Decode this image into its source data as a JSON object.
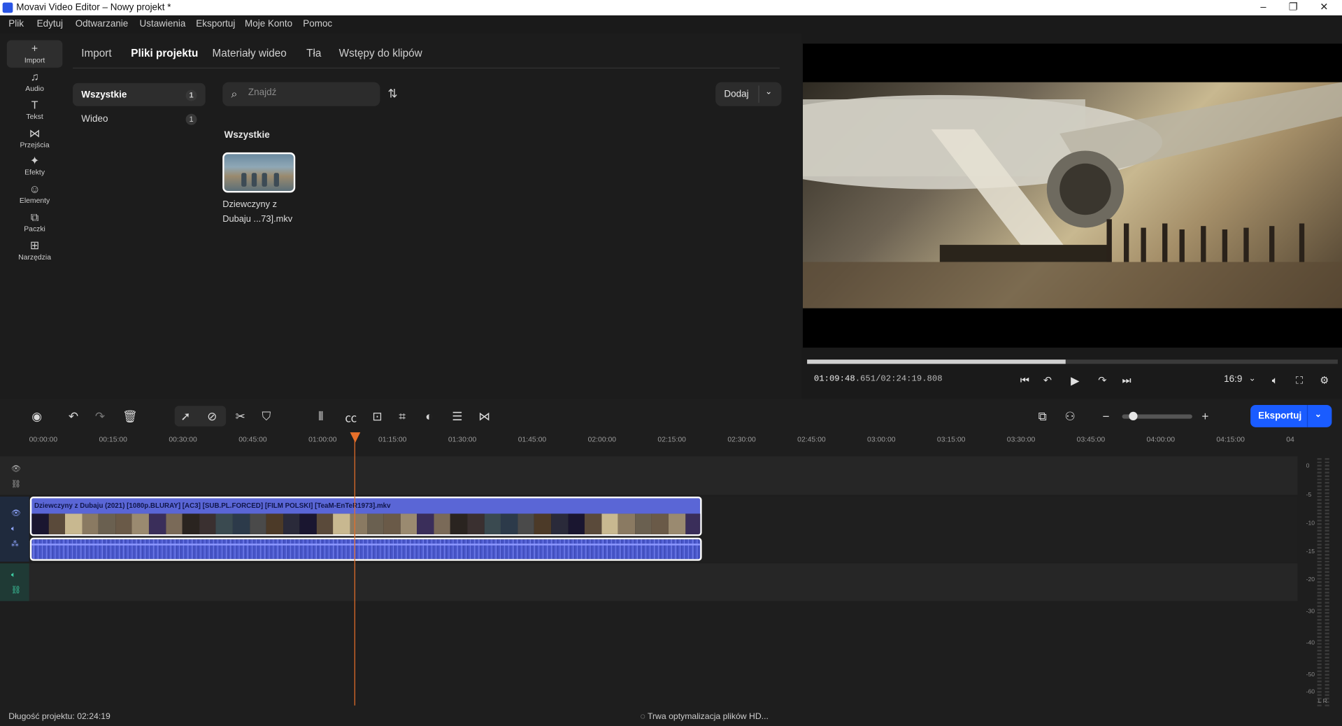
{
  "window": {
    "title": "Movavi Video Editor – Nowy projekt *",
    "minimize": "–",
    "maximize": "❐",
    "close": "✕"
  },
  "menu": [
    "Plik",
    "Edytuj",
    "Odtwarzanie",
    "Ustawienia",
    "Eksportuj",
    "Moje Konto",
    "Pomoc"
  ],
  "sidebar": [
    {
      "label": "Import",
      "icon": "+"
    },
    {
      "label": "Audio",
      "icon": "♫"
    },
    {
      "label": "Tekst",
      "icon": "T"
    },
    {
      "label": "Przejścia",
      "icon": "⋈"
    },
    {
      "label": "Efekty",
      "icon": "✦"
    },
    {
      "label": "Elementy",
      "icon": "☺"
    },
    {
      "label": "Paczki",
      "icon": "⧉"
    },
    {
      "label": "Narzędzia",
      "icon": "⊞"
    }
  ],
  "tabs": [
    "Import",
    "Pliki projektu",
    "Materiały wideo",
    "Tła",
    "Wstępy do klipów"
  ],
  "categories": [
    {
      "label": "Wszystkie",
      "count": "1"
    },
    {
      "label": "Wideo",
      "count": "1"
    }
  ],
  "search": {
    "placeholder": "Znajdź"
  },
  "add_button": {
    "label": "Dodaj"
  },
  "section_title": "Wszystkie",
  "media": {
    "filename": "Dziewczyny z Dubaju ...73].mkv"
  },
  "player": {
    "current": "01:09:48",
    "current_ms": ".651",
    "total": "/02:24:19.808",
    "aspect": "16:9",
    "progress": 0.487
  },
  "export_button": {
    "label": "Eksportuj"
  },
  "ruler": [
    "00:00:00",
    "00:15:00",
    "00:30:00",
    "00:45:00",
    "01:00:00",
    "01:15:00",
    "01:30:00",
    "01:45:00",
    "02:00:00",
    "02:15:00",
    "02:30:00",
    "02:45:00",
    "03:00:00",
    "03:15:00",
    "03:30:00",
    "03:45:00",
    "04:00:00",
    "04:15:00",
    "04"
  ],
  "clip": {
    "title": "Dziewczyny z Dubaju (2021) [1080p.BLURAY] [AC3] [SUB.PL.FORCED] [FILM POLSKI] [TeaM-EnTeR1973].mkv"
  },
  "meter": {
    "labels": [
      "0",
      "-5",
      "-10",
      "-15",
      "-20",
      "-30",
      "-40",
      "-50",
      "-60"
    ],
    "channels": "L   R"
  },
  "status": {
    "project_length": "Długość projektu: 02:24:19",
    "optimizing": "Trwa optymalizacja plików HD..."
  }
}
